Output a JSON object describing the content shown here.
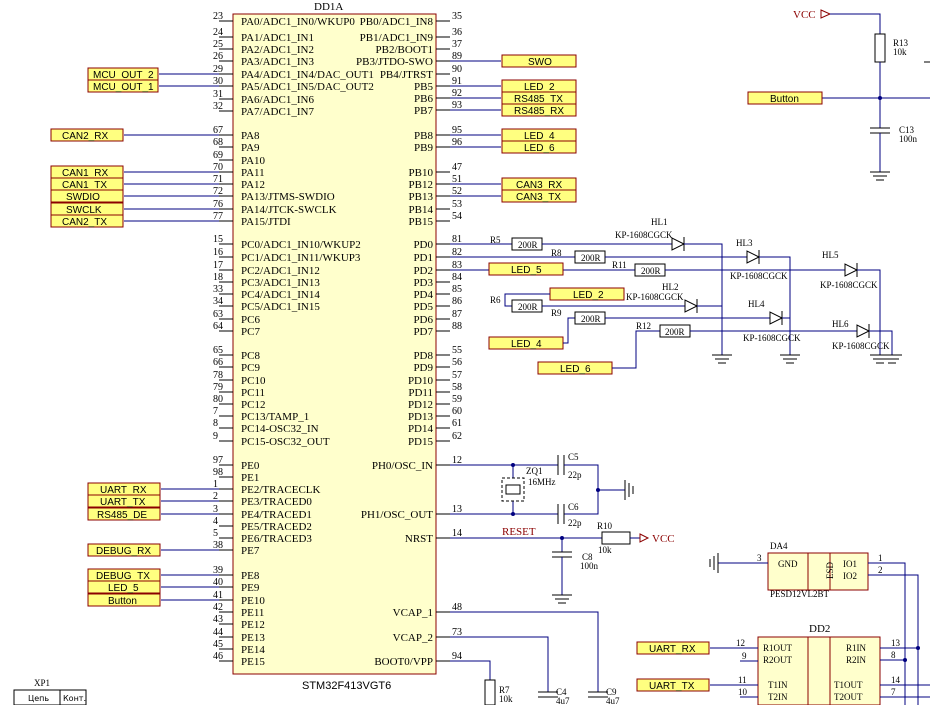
{
  "ic_main": {
    "designator": "DD1A",
    "part": "STM32F413VGT6",
    "left_pins": [
      {
        "num": "23",
        "label": "PA0/ADC1_IN0/WKUP0"
      },
      {
        "num": "24",
        "label": "PA1/ADC1_IN1"
      },
      {
        "num": "25",
        "label": "PA2/ADC1_IN2"
      },
      {
        "num": "26",
        "label": "PA3/ADC1_IN3"
      },
      {
        "num": "29",
        "label": "PA4/ADC1_IN4/DAC_OUT1"
      },
      {
        "num": "30",
        "label": "PA5/ADC1_IN5/DAC_OUT2"
      },
      {
        "num": "31",
        "label": "PA6/ADC1_IN6"
      },
      {
        "num": "32",
        "label": "PA7/ADC1_IN7"
      },
      {
        "num": "67",
        "label": "PA8"
      },
      {
        "num": "68",
        "label": "PA9"
      },
      {
        "num": "69",
        "label": "PA10"
      },
      {
        "num": "70",
        "label": "PA11"
      },
      {
        "num": "71",
        "label": "PA12"
      },
      {
        "num": "72",
        "label": "PA13/JTMS-SWDIO"
      },
      {
        "num": "76",
        "label": "PA14/JTCK-SWCLK"
      },
      {
        "num": "77",
        "label": "PA15/JTDI"
      },
      {
        "num": "15",
        "label": "PC0/ADC1_IN10/WKUP2"
      },
      {
        "num": "16",
        "label": "PC1/ADC1_IN11/WKUP3"
      },
      {
        "num": "17",
        "label": "PC2/ADC1_IN12"
      },
      {
        "num": "18",
        "label": "PC3/ADC1_IN13"
      },
      {
        "num": "33",
        "label": "PC4/ADC1_IN14"
      },
      {
        "num": "34",
        "label": "PC5/ADC1_IN15"
      },
      {
        "num": "63",
        "label": "PC6"
      },
      {
        "num": "64",
        "label": "PC7"
      },
      {
        "num": "65",
        "label": "PC8"
      },
      {
        "num": "66",
        "label": "PC9"
      },
      {
        "num": "78",
        "label": "PC10"
      },
      {
        "num": "79",
        "label": "PC11"
      },
      {
        "num": "80",
        "label": "PC12"
      },
      {
        "num": "7",
        "label": "PC13/TAMP_1"
      },
      {
        "num": "8",
        "label": "PC14-OSC32_IN"
      },
      {
        "num": "9",
        "label": "PC15-OSC32_OUT"
      },
      {
        "num": "97",
        "label": "PE0"
      },
      {
        "num": "98",
        "label": "PE1"
      },
      {
        "num": "1",
        "label": "PE2/TRACECLK"
      },
      {
        "num": "2",
        "label": "PE3/TRACED0"
      },
      {
        "num": "3",
        "label": "PE4/TRACED1"
      },
      {
        "num": "4",
        "label": "PE5/TRACED2"
      },
      {
        "num": "5",
        "label": "PE6/TRACED3"
      },
      {
        "num": "38",
        "label": "PE7"
      },
      {
        "num": "39",
        "label": "PE8"
      },
      {
        "num": "40",
        "label": "PE9"
      },
      {
        "num": "41",
        "label": "PE10"
      },
      {
        "num": "42",
        "label": "PE11"
      },
      {
        "num": "43",
        "label": "PE12"
      },
      {
        "num": "44",
        "label": "PE13"
      },
      {
        "num": "45",
        "label": "PE14"
      },
      {
        "num": "46",
        "label": "PE15"
      }
    ],
    "right_pins": [
      {
        "num": "35",
        "label": "PB0/ADC1_IN8"
      },
      {
        "num": "36",
        "label": "PB1/ADC1_IN9"
      },
      {
        "num": "37",
        "label": "PB2/BOOT1"
      },
      {
        "num": "89",
        "label": "PB3/JTDO-SWO"
      },
      {
        "num": "90",
        "label": "PB4/JTRST"
      },
      {
        "num": "91",
        "label": "PB5"
      },
      {
        "num": "92",
        "label": "PB6"
      },
      {
        "num": "93",
        "label": "PB7"
      },
      {
        "num": "95",
        "label": "PB8"
      },
      {
        "num": "96",
        "label": "PB9"
      },
      {
        "num": "47",
        "label": "PB10"
      },
      {
        "num": "51",
        "label": "PB12"
      },
      {
        "num": "52",
        "label": "PB13"
      },
      {
        "num": "53",
        "label": "PB14"
      },
      {
        "num": "54",
        "label": "PB15"
      },
      {
        "num": "81",
        "label": "PD0"
      },
      {
        "num": "82",
        "label": "PD1"
      },
      {
        "num": "83",
        "label": "PD2"
      },
      {
        "num": "84",
        "label": "PD3"
      },
      {
        "num": "85",
        "label": "PD4"
      },
      {
        "num": "86",
        "label": "PD5"
      },
      {
        "num": "87",
        "label": "PD6"
      },
      {
        "num": "88",
        "label": "PD7"
      },
      {
        "num": "55",
        "label": "PD8"
      },
      {
        "num": "56",
        "label": "PD9"
      },
      {
        "num": "57",
        "label": "PD10"
      },
      {
        "num": "58",
        "label": "PD11"
      },
      {
        "num": "59",
        "label": "PD12"
      },
      {
        "num": "60",
        "label": "PD13"
      },
      {
        "num": "61",
        "label": "PD14"
      },
      {
        "num": "62",
        "label": "PD15"
      },
      {
        "num": "12",
        "label": "PH0/OSC_IN"
      },
      {
        "num": "13",
        "label": "PH1/OSC_OUT"
      },
      {
        "num": "14",
        "label": "NRST"
      },
      {
        "num": "48",
        "label": "VCAP_1"
      },
      {
        "num": "73",
        "label": "VCAP_2"
      },
      {
        "num": "94",
        "label": "BOOT0/VPP"
      }
    ]
  },
  "net_ports": {
    "left": [
      "MCU_OUT_2",
      "MCU_OUT_1",
      "CAN2_RX",
      "CAN1_RX",
      "CAN1_TX",
      "SWDIO",
      "SWCLK",
      "CAN2_TX",
      "UART_RX",
      "UART_TX",
      "RS485_DE",
      "DEBUG_RX",
      "DEBUG_TX",
      "LED_5",
      "Button"
    ],
    "right": [
      "SWO",
      "LED_2",
      "RS485_TX",
      "RS485_RX",
      "LED_4",
      "LED_6",
      "CAN3_RX",
      "CAN3_TX"
    ],
    "led_area": [
      "LED_5",
      "LED_2",
      "LED_4",
      "LED_6"
    ],
    "other": [
      "Button",
      "UART_RX",
      "UART_TX"
    ]
  },
  "leds": {
    "part": "KP-1608CGCK",
    "designators": [
      "HL1",
      "HL2",
      "HL3",
      "HL4",
      "HL5",
      "HL6"
    ],
    "resistors": [
      "R5",
      "R6",
      "R8",
      "R9",
      "R11",
      "R12"
    ],
    "resistor_value": "200R"
  },
  "components": {
    "vcc": "VCC",
    "r13": {
      "ref": "R13",
      "value": "10k"
    },
    "c13": {
      "ref": "C13",
      "value": "100n"
    },
    "c5": {
      "ref": "C5",
      "value": "22p"
    },
    "c6": {
      "ref": "C6",
      "value": "22p"
    },
    "zq1": {
      "ref": "ZQ1",
      "value": "16MHz"
    },
    "r10": {
      "ref": "R10",
      "value": "10k"
    },
    "c8": {
      "ref": "C8",
      "value": "100n"
    },
    "reset": "RESET",
    "r7": {
      "ref": "R7",
      "value": "10k"
    },
    "c4": {
      "ref": "C4",
      "value": "4u7"
    },
    "c9": {
      "ref": "C9",
      "value": "4u7"
    },
    "da4": {
      "ref": "DA4",
      "part": "PESD12VL2BT",
      "gnd": "GND",
      "esd": "ESD",
      "io1": "IO1",
      "io2": "IO2",
      "pin_gnd": "3",
      "pin_io1": "1",
      "pin_io2": "2"
    },
    "dd2": {
      "ref": "DD2",
      "r1out": "R1OUT",
      "r2out": "R2OUT",
      "t1in": "T1IN",
      "t2in": "T2IN",
      "r1in": "R1IN",
      "r2in": "R2IN",
      "t1out": "T1OUT",
      "t2out": "T2OUT",
      "p12": "12",
      "p9": "9",
      "p11": "11",
      "p10": "10",
      "p13": "13",
      "p8": "8",
      "p14": "14",
      "p7": "7"
    },
    "xp1": {
      "ref": "XP1",
      "col1": "Цепь",
      "col2": "Конт."
    }
  },
  "colors": {
    "wire": "#000080",
    "port_fill": "#ffff80",
    "port_border": "#8b0000",
    "net_red": "#8b0000"
  }
}
